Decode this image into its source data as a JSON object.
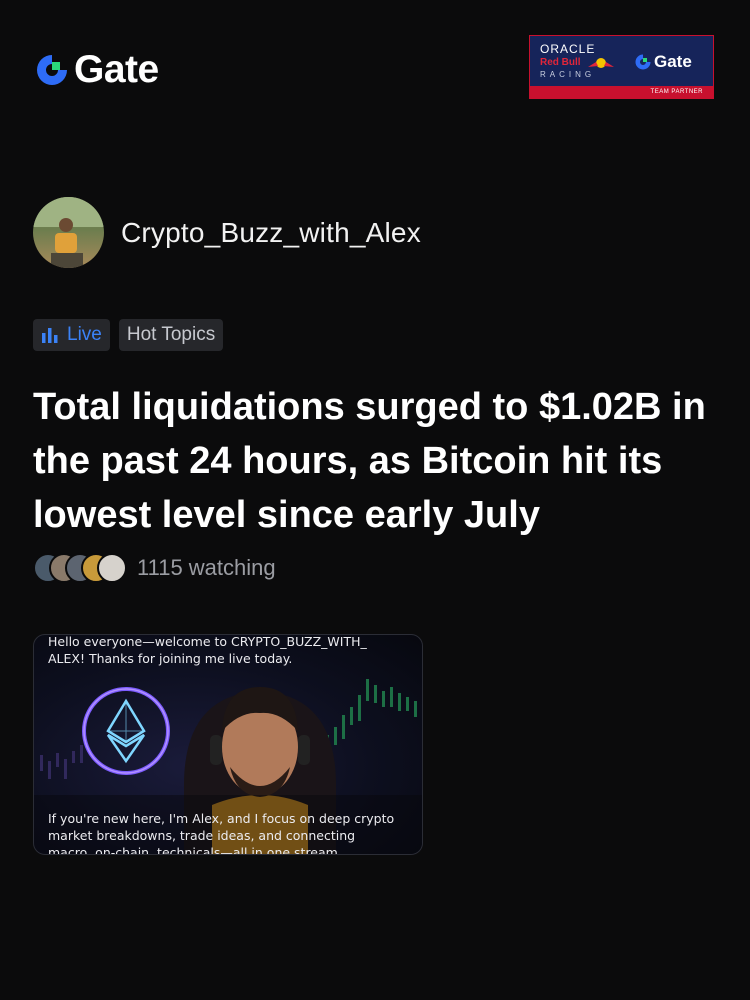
{
  "brand": {
    "logo_text": "Gate"
  },
  "partner_badge": {
    "oracle": "ORACLE",
    "red_bull": "Red Bull",
    "racing": "RACING",
    "gate": "Gate",
    "team_partner": "TEAM PARTNER"
  },
  "author": {
    "name": "Crypto_Buzz_with_Alex"
  },
  "tags": {
    "live": "Live",
    "topic": "Hot Topics"
  },
  "headline": "Total liquidations surged to $1.02B in the past 24 hours, as Bitcoin hit its lowest level since early July",
  "watchers": {
    "count_text": "1115 watching"
  },
  "video": {
    "caption_top": "Hello everyone—welcome to CRYPTO_BUZZ_WITH_ ALEX! Thanks for joining me live today.",
    "caption_bottom": "If you're new here, I'm Alex, and I focus on deep crypto market breakdowns, trade ideas, and connecting macro, on-chain, technicals—all in one stream."
  },
  "colors": {
    "accent": "#3b82f6",
    "brand_green": "#2bd97a",
    "background": "#0b0b0c"
  }
}
